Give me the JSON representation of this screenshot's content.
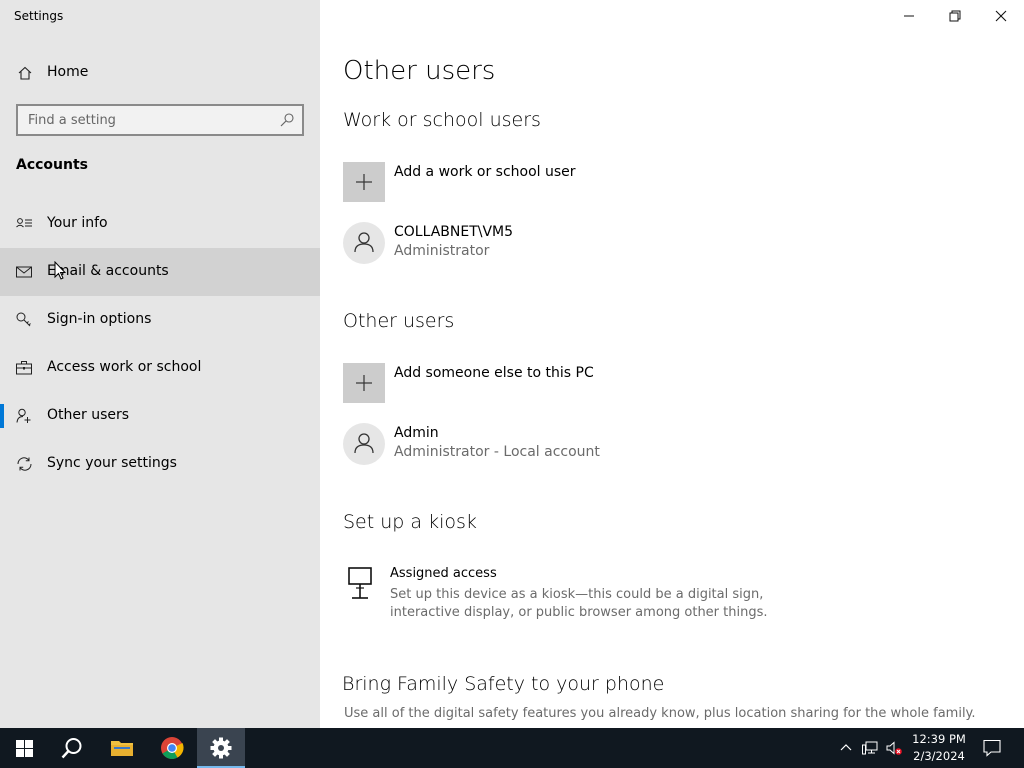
{
  "window": {
    "title": "Settings"
  },
  "sidebar": {
    "home_label": "Home",
    "search_placeholder": "Find a setting",
    "section": "Accounts",
    "items": [
      {
        "label": "Your info",
        "icon": "your-info-icon"
      },
      {
        "label": "Email & accounts",
        "icon": "mail-icon"
      },
      {
        "label": "Sign-in options",
        "icon": "key-icon"
      },
      {
        "label": "Access work or school",
        "icon": "briefcase-icon"
      },
      {
        "label": "Other users",
        "icon": "add-person-icon",
        "selected": true
      },
      {
        "label": "Sync your settings",
        "icon": "sync-icon"
      }
    ]
  },
  "main": {
    "title": "Other users",
    "work": {
      "heading": "Work or school users",
      "add_label": "Add a work or school user",
      "user": {
        "name": "COLLABNET\\VM5",
        "role": "Administrator"
      }
    },
    "other": {
      "heading": "Other users",
      "add_label": "Add someone else to this PC",
      "user": {
        "name": "Admin",
        "role": "Administrator - Local account"
      }
    },
    "kiosk": {
      "heading": "Set up a kiosk",
      "title": "Assigned access",
      "desc": "Set up this device as a kiosk—this could be a digital sign, interactive display, or public browser among other things."
    },
    "family": {
      "heading": "Bring Family Safety to your phone",
      "desc": "Use all of the digital safety features you already know, plus location sharing for the whole family."
    }
  },
  "taskbar": {
    "time": "12:39 PM",
    "date": "2/3/2024"
  },
  "colors": {
    "accent": "#0078d7",
    "sidebar_bg": "#e6e6e6",
    "taskbar_bg": "#101820"
  }
}
